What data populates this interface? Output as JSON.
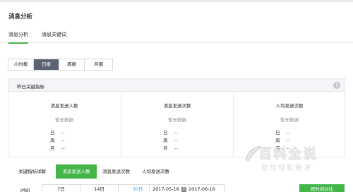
{
  "page": {
    "title": "消息分析"
  },
  "subnav": {
    "items": [
      "消息分析",
      "消息关键词"
    ],
    "active_index": 0
  },
  "range_tabs": {
    "items": [
      "小时报",
      "日报",
      "周报",
      "月报"
    ],
    "active_index": 1
  },
  "yesterday_panel": {
    "title": "昨日关键指标",
    "help_icon": "?",
    "columns": [
      {
        "title": "消息发送人数",
        "empty_text": "暂无数据",
        "rows": [
          {
            "label": "日",
            "value": "--"
          },
          {
            "label": "周",
            "value": "--"
          },
          {
            "label": "月",
            "value": "--"
          }
        ]
      },
      {
        "title": "消息发送次数",
        "empty_text": "暂无数据",
        "rows": [
          {
            "label": "日",
            "value": "--"
          },
          {
            "label": "周",
            "value": "--"
          },
          {
            "label": "月",
            "value": "--"
          }
        ]
      },
      {
        "title": "人均发送次数",
        "empty_text": "暂无数据",
        "rows": [
          {
            "label": "日",
            "value": "--"
          },
          {
            "label": "周",
            "value": "--"
          },
          {
            "label": "月",
            "value": "--"
          }
        ]
      }
    ]
  },
  "detail_tabs": {
    "items": [
      "关键指标详解",
      "消息发送人数",
      "消息发送次数",
      "人均发送次数"
    ],
    "active_index": 1
  },
  "filter": {
    "label": "时间",
    "periods": [
      "7日",
      "14日",
      "30日"
    ],
    "date_start": "2017-05-18",
    "date_sep": "至",
    "date_end": "2017-06-16",
    "compare_button": "按时间对比"
  },
  "watermark": {
    "line1": "百科全说",
    "line2": "助你轻松解决"
  },
  "colors": {
    "accent": "#44b549",
    "active_tab": "#5b6271",
    "link": "#459ae9"
  }
}
